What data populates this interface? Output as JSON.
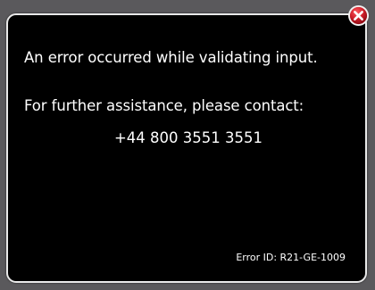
{
  "dialog": {
    "message": "An error occurred while validating input.",
    "assistance": "For further assistance, please contact:",
    "phone": "+44 800 3551 3551",
    "error_id": "Error ID: R21-GE-1009"
  },
  "close_button": {
    "icon": "close-icon",
    "color": "#c8102e"
  },
  "colors": {
    "background": "#5a595c",
    "dialog_background": "#000000",
    "dialog_border": "#e9e9e9",
    "text": "#ffffff"
  }
}
